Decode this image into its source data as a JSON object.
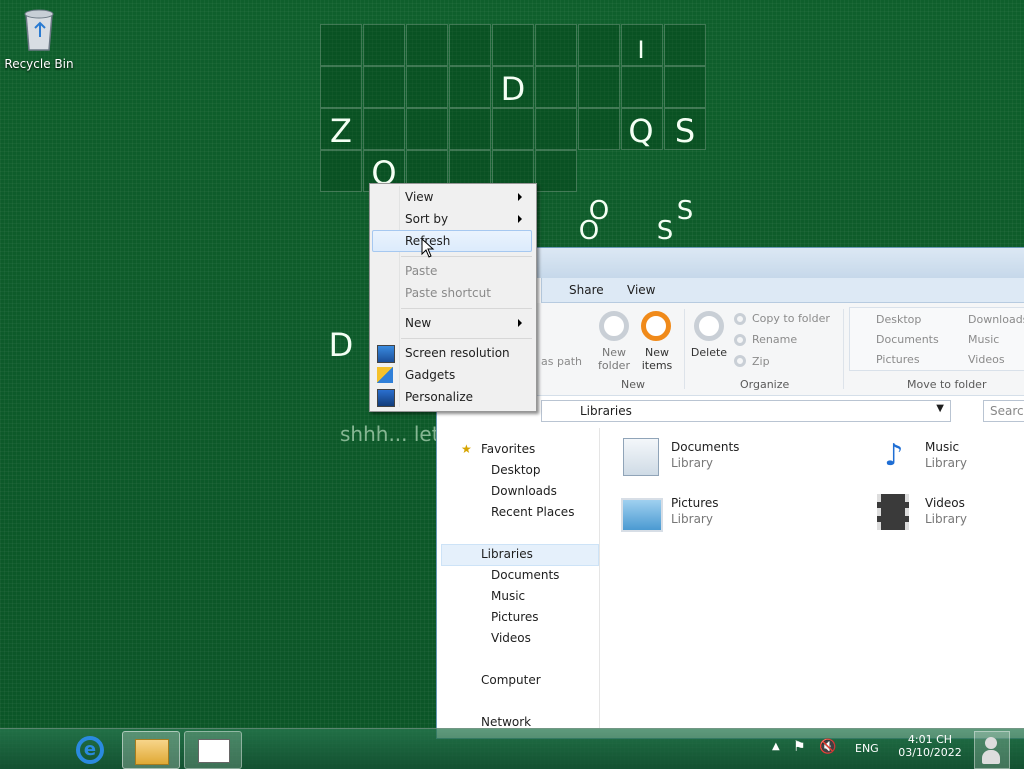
{
  "desktop": {
    "recycle_bin_label": "Recycle Bin",
    "grid_letters": [
      "I",
      "D",
      "Z",
      "Q",
      "S",
      "O",
      "O",
      "S",
      "O",
      "S",
      "D"
    ],
    "hint_text": "shhh... let"
  },
  "context_menu": {
    "items": [
      {
        "label": "View",
        "submenu": true,
        "disabled": false
      },
      {
        "label": "Sort by",
        "submenu": true,
        "disabled": false
      },
      {
        "label": "Refresh",
        "submenu": false,
        "disabled": false,
        "highlighted": true
      },
      {
        "label": "Paste",
        "submenu": false,
        "disabled": true
      },
      {
        "label": "Paste shortcut",
        "submenu": false,
        "disabled": true
      },
      {
        "label": "New",
        "submenu": true,
        "disabled": false
      },
      {
        "label": "Screen resolution",
        "icon": "monitor-icon"
      },
      {
        "label": "Gadgets",
        "icon": "gadgets-icon"
      },
      {
        "label": "Personalize",
        "icon": "personalize-icon"
      }
    ]
  },
  "explorer": {
    "ribbon_tabs": [
      "Share",
      "View"
    ],
    "ribbon": {
      "copy_path_partial": "as path",
      "new_folder": "New folder",
      "new_items": "New items",
      "new_group": "New",
      "delete": "Delete",
      "copy_to_folder": "Copy to folder",
      "rename": "Rename",
      "zip": "Zip",
      "organize_group": "Organize",
      "move_items": [
        "Desktop",
        "Documents",
        "Pictures",
        "Downloads",
        "Music",
        "Videos"
      ],
      "move_group": "Move to folder"
    },
    "address": "Libraries",
    "search_placeholder": "Search",
    "nav": {
      "favorites": "Favorites",
      "favorites_items": [
        "Desktop",
        "Downloads",
        "Recent Places"
      ],
      "libraries": "Libraries",
      "libraries_items": [
        "Documents",
        "Music",
        "Pictures",
        "Videos"
      ],
      "computer": "Computer",
      "network": "Network"
    },
    "libraries": [
      {
        "name": "Documents",
        "sub": "Library"
      },
      {
        "name": "Music",
        "sub": "Library"
      },
      {
        "name": "Pictures",
        "sub": "Library"
      },
      {
        "name": "Videos",
        "sub": "Library"
      }
    ]
  },
  "taskbar": {
    "lang": "ENG",
    "time": "4:01 CH",
    "date": "03/10/2022"
  }
}
